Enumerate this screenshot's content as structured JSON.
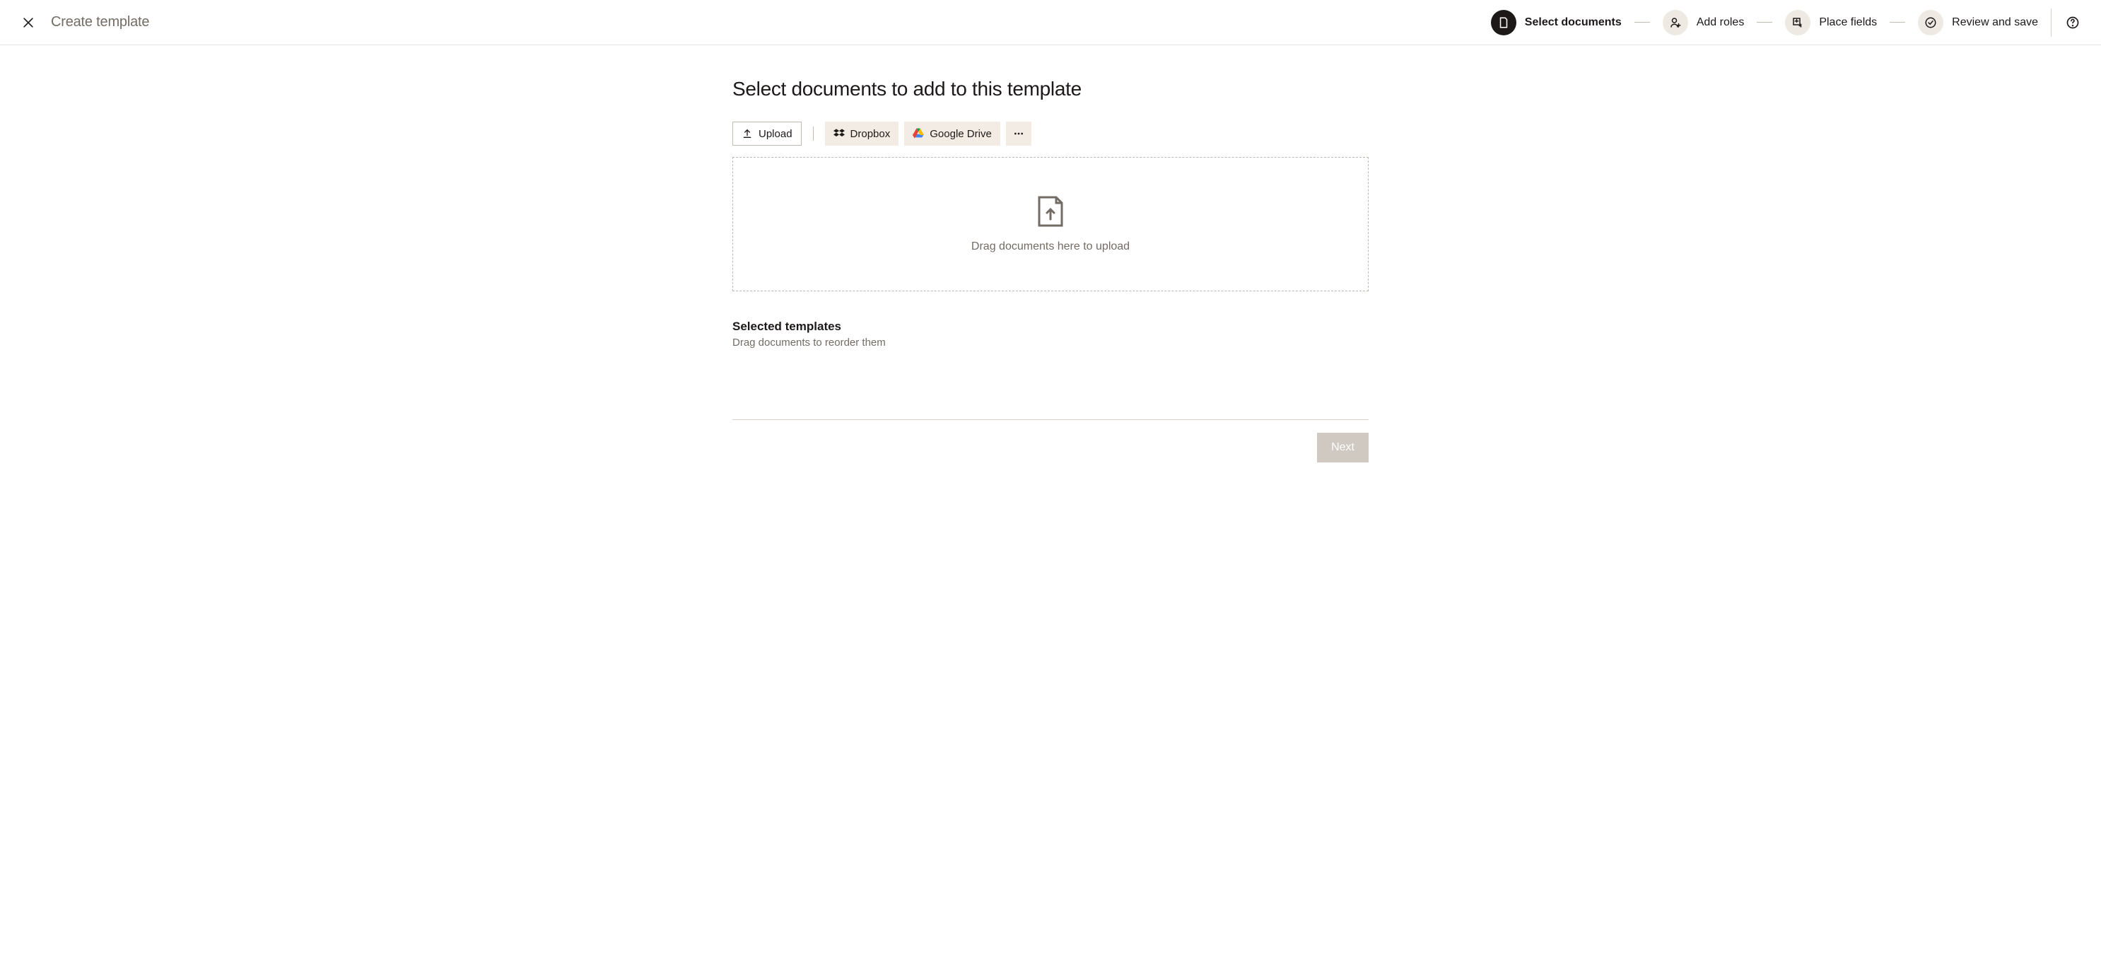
{
  "header": {
    "title": "Create template",
    "steps": [
      {
        "label": "Select documents"
      },
      {
        "label": "Add roles"
      },
      {
        "label": "Place fields"
      },
      {
        "label": "Review and save"
      }
    ]
  },
  "main": {
    "heading": "Select documents to add to this template",
    "sources": {
      "upload": "Upload",
      "dropbox": "Dropbox",
      "google_drive": "Google Drive"
    },
    "dropzone_text": "Drag documents here to upload",
    "selected_title": "Selected templates",
    "selected_sub": "Drag documents to reorder them",
    "next_label": "Next"
  }
}
